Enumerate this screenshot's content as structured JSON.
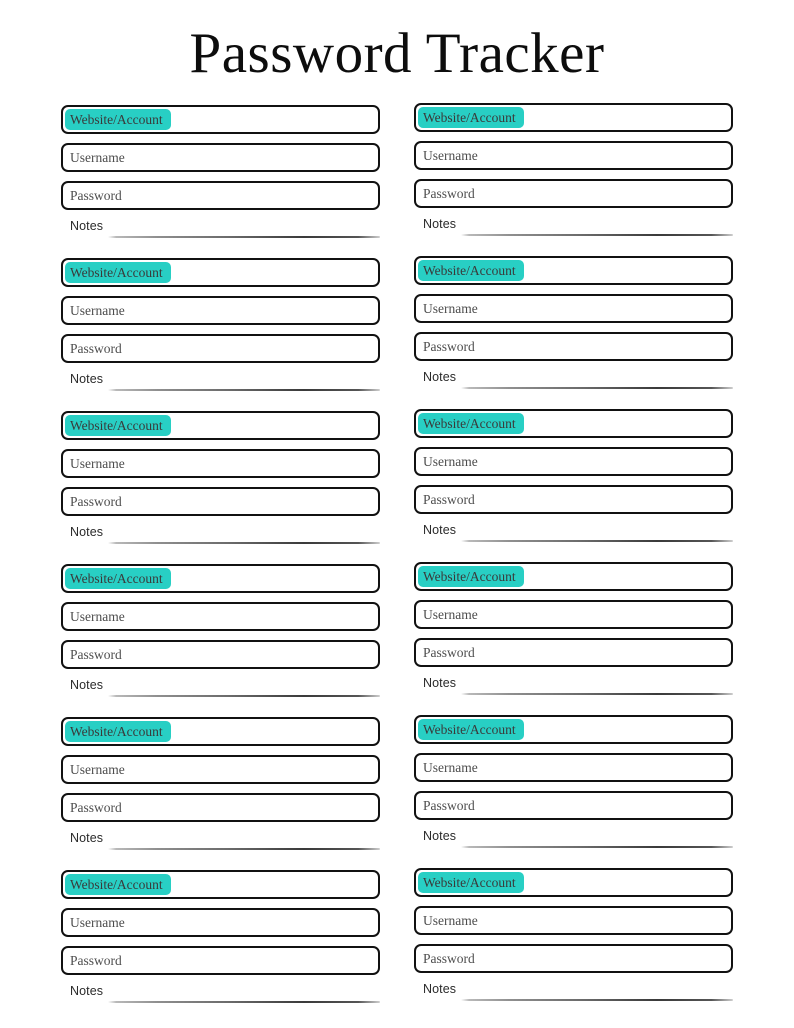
{
  "document": {
    "title": "Password Tracker",
    "page_background": "#ffffff",
    "accent_color": "#28cfc4",
    "border_color": "#111111",
    "field_text_color": "#4d4d4d",
    "notes_text_color": "#2b2b2b"
  },
  "labels": {
    "website": "Website/Account",
    "username": "Username",
    "password": "Password",
    "notes": "Notes"
  },
  "columns": [
    {
      "name": "left-column",
      "entries": [
        {
          "website": "Website/Account",
          "username": "Username",
          "password": "Password",
          "notes": "Notes",
          "website_value": "",
          "username_value": "",
          "password_value": "",
          "notes_value": ""
        },
        {
          "website": "Website/Account",
          "username": "Username",
          "password": "Password",
          "notes": "Notes",
          "website_value": "",
          "username_value": "",
          "password_value": "",
          "notes_value": ""
        },
        {
          "website": "Website/Account",
          "username": "Username",
          "password": "Password",
          "notes": "Notes",
          "website_value": "",
          "username_value": "",
          "password_value": "",
          "notes_value": ""
        },
        {
          "website": "Website/Account",
          "username": "Username",
          "password": "Password",
          "notes": "Notes",
          "website_value": "",
          "username_value": "",
          "password_value": "",
          "notes_value": ""
        },
        {
          "website": "Website/Account",
          "username": "Username",
          "password": "Password",
          "notes": "Notes",
          "website_value": "",
          "username_value": "",
          "password_value": "",
          "notes_value": ""
        },
        {
          "website": "Website/Account",
          "username": "Username",
          "password": "Password",
          "notes": "Notes",
          "website_value": "",
          "username_value": "",
          "password_value": "",
          "notes_value": ""
        }
      ]
    },
    {
      "name": "right-column",
      "entries": [
        {
          "website": "Website/Account",
          "username": "Username",
          "password": "Password",
          "notes": "Notes",
          "website_value": "",
          "username_value": "",
          "password_value": "",
          "notes_value": ""
        },
        {
          "website": "Website/Account",
          "username": "Username",
          "password": "Password",
          "notes": "Notes",
          "website_value": "",
          "username_value": "",
          "password_value": "",
          "notes_value": ""
        },
        {
          "website": "Website/Account",
          "username": "Username",
          "password": "Password",
          "notes": "Notes",
          "website_value": "",
          "username_value": "",
          "password_value": "",
          "notes_value": ""
        },
        {
          "website": "Website/Account",
          "username": "Username",
          "password": "Password",
          "notes": "Notes",
          "website_value": "",
          "username_value": "",
          "password_value": "",
          "notes_value": ""
        },
        {
          "website": "Website/Account",
          "username": "Username",
          "password": "Password",
          "notes": "Notes",
          "website_value": "",
          "username_value": "",
          "password_value": "",
          "notes_value": ""
        },
        {
          "website": "Website/Account",
          "username": "Username",
          "password": "Password",
          "notes": "Notes",
          "website_value": "",
          "username_value": "",
          "password_value": "",
          "notes_value": ""
        }
      ]
    }
  ]
}
